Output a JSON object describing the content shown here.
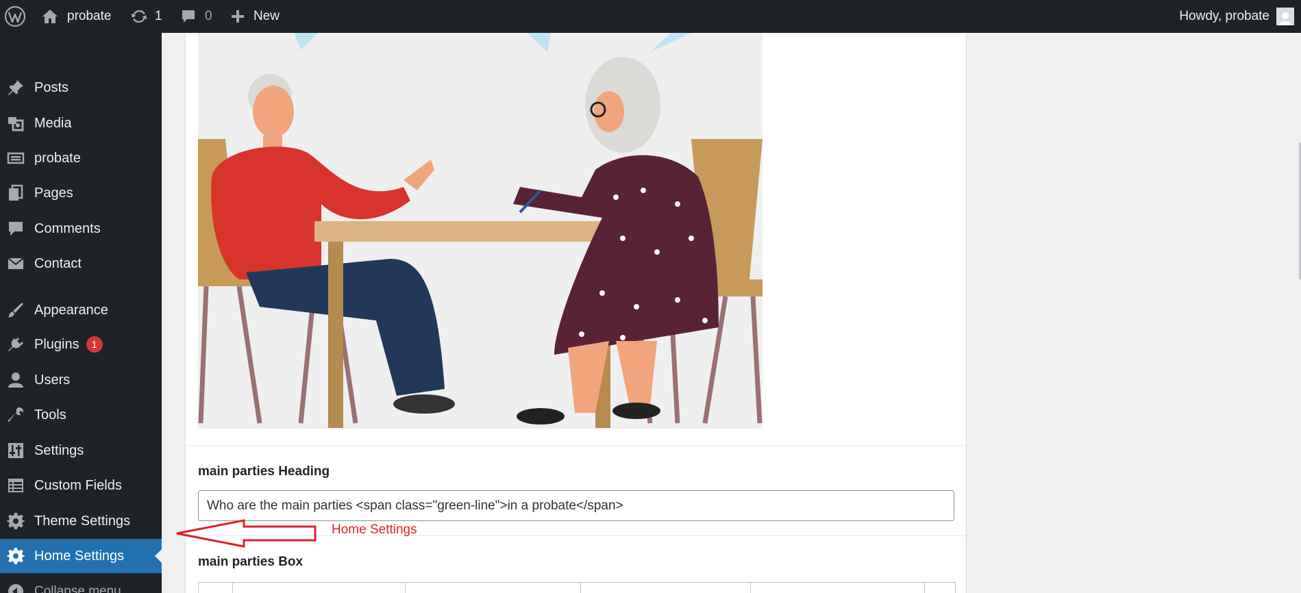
{
  "admin_bar": {
    "wp_logo_icon": "wordpress-icon",
    "site_name": "probate",
    "updates_count": "1",
    "comments_count": "0",
    "new_label": "New",
    "howdy": "Howdy, probate"
  },
  "sidebar": {
    "items": [
      {
        "label": "Posts",
        "icon": "pin-icon"
      },
      {
        "label": "Media",
        "icon": "media-icon"
      },
      {
        "label": "probate",
        "icon": "archive-icon"
      },
      {
        "label": "Pages",
        "icon": "pages-icon"
      },
      {
        "label": "Comments",
        "icon": "comment-icon"
      },
      {
        "label": "Contact",
        "icon": "envelope-icon"
      },
      {
        "label": "Appearance",
        "icon": "brush-icon"
      },
      {
        "label": "Plugins",
        "icon": "plug-icon",
        "badge": "1"
      },
      {
        "label": "Users",
        "icon": "user-icon"
      },
      {
        "label": "Tools",
        "icon": "wrench-icon"
      },
      {
        "label": "Settings",
        "icon": "sliders-icon"
      },
      {
        "label": "Custom Fields",
        "icon": "table-icon"
      },
      {
        "label": "Theme Settings",
        "icon": "gear-icon"
      },
      {
        "label": "Home Settings",
        "icon": "gear-icon",
        "active": true
      }
    ],
    "collapse_label": "Collapse menu"
  },
  "main": {
    "illustration_alt": "illustration",
    "heading_field": {
      "label": "main parties Heading",
      "value": "Who are the main parties <span class=\"green-line\">in a probate</span>"
    },
    "box_field": {
      "label": "main parties Box"
    }
  },
  "annotation": {
    "label": "Home Settings",
    "color": "#e0202a"
  },
  "colors": {
    "admin_bg": "#1d2327",
    "active_bg": "#2271b1",
    "badge": "#d63638"
  }
}
